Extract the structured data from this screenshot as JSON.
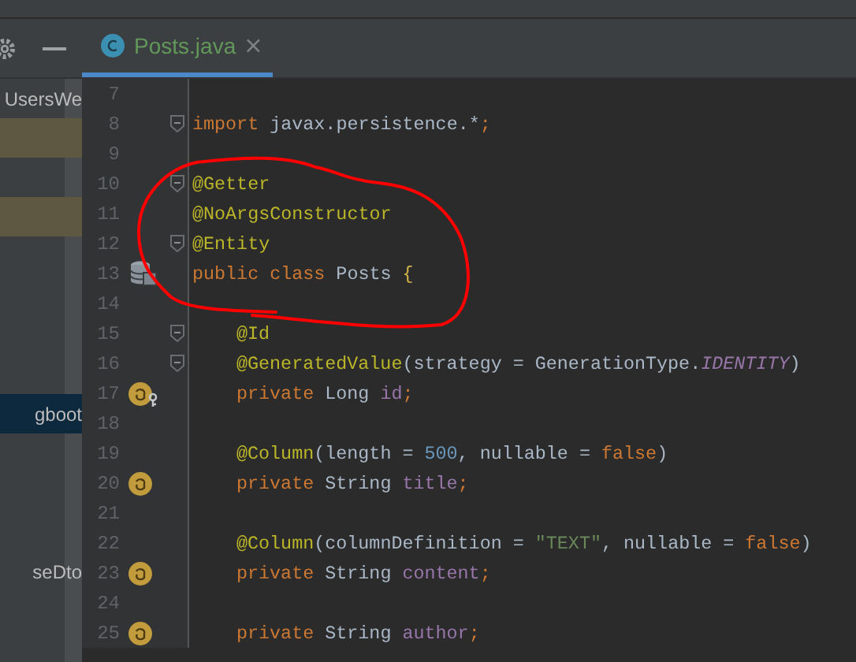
{
  "tab": {
    "label": "Posts.java",
    "selected": true
  },
  "sidebar": {
    "items": [
      {
        "text": "UsersWe",
        "highlighted": false,
        "selected": false
      },
      {
        "highlighted": true,
        "selected": false
      },
      {
        "highlighted": false,
        "selected": false
      },
      {
        "highlighted": true,
        "selected": false
      },
      {
        "highlighted": false,
        "selected": false
      },
      {
        "highlighted": false,
        "selected": false
      },
      {
        "highlighted": false,
        "selected": false
      },
      {
        "highlighted": false,
        "selected": false
      },
      {
        "text": "gboot",
        "highlighted": false,
        "selected": true
      },
      {
        "highlighted": false,
        "selected": false
      },
      {
        "highlighted": false,
        "selected": false
      },
      {
        "highlighted": false,
        "selected": false
      },
      {
        "text": "seDto",
        "highlighted": false,
        "selected": false
      }
    ]
  },
  "editor": {
    "lines": [
      {
        "n": "7",
        "kind": "plain",
        "fold": false
      },
      {
        "n": "8",
        "kind": "plain",
        "fold": true,
        "indent": false,
        "tokens": [
          {
            "t": "import",
            "kind": "kw"
          },
          {
            "t": " javax.persistence.*",
            "kind": "plain"
          },
          {
            "t": ";",
            "kind": "kw"
          }
        ]
      },
      {
        "n": "9",
        "kind": "plain",
        "fold": false
      },
      {
        "n": "10",
        "kind": "plain",
        "fold": true,
        "indent": false,
        "tokens": [
          {
            "t": "@Getter",
            "kind": "ann"
          }
        ]
      },
      {
        "n": "11",
        "kind": "plain",
        "fold": false,
        "indent": false,
        "tokens": [
          {
            "t": "@NoArgsConstructor",
            "kind": "ann"
          }
        ]
      },
      {
        "n": "12",
        "kind": "plain",
        "fold": true,
        "indent": false,
        "tokens": [
          {
            "t": "@Entity",
            "kind": "ann"
          }
        ]
      },
      {
        "n": "13",
        "kind": "entity",
        "fold": false,
        "indent": false,
        "tokens": [
          {
            "t": "public class",
            "kind": "kw"
          },
          {
            "t": " Posts ",
            "kind": "plain"
          },
          {
            "t": "{",
            "kind": "brace"
          }
        ]
      },
      {
        "n": "14",
        "kind": "plain",
        "fold": false
      },
      {
        "n": "15",
        "kind": "plain",
        "fold": true,
        "indent": true,
        "tokens": [
          {
            "t": "@Id",
            "kind": "ann"
          }
        ]
      },
      {
        "n": "16",
        "kind": "plain",
        "fold": true,
        "indent": true,
        "tokens": [
          {
            "t": "@GeneratedValue",
            "kind": "ann"
          },
          {
            "t": "(strategy = GenerationType.",
            "kind": "plain"
          },
          {
            "t": "IDENTITY",
            "kind": "static"
          },
          {
            "t": ")",
            "kind": "plain"
          }
        ]
      },
      {
        "n": "17",
        "kind": "id-field",
        "fold": false,
        "indent": true,
        "tokens": [
          {
            "t": "private",
            "kind": "kw"
          },
          {
            "t": " Long ",
            "kind": "plain"
          },
          {
            "t": "id",
            "kind": "field"
          },
          {
            "t": ";",
            "kind": "kw"
          }
        ]
      },
      {
        "n": "18",
        "kind": "plain",
        "fold": false
      },
      {
        "n": "19",
        "kind": "plain",
        "fold": false,
        "indent": true,
        "tokens": [
          {
            "t": "@Column",
            "kind": "ann"
          },
          {
            "t": "(length = ",
            "kind": "plain"
          },
          {
            "t": "500",
            "kind": "num"
          },
          {
            "t": ", nullable = ",
            "kind": "plain"
          },
          {
            "t": "false",
            "kind": "kw"
          },
          {
            "t": ")",
            "kind": "plain"
          }
        ]
      },
      {
        "n": "20",
        "kind": "field",
        "fold": false,
        "indent": true,
        "tokens": [
          {
            "t": "private",
            "kind": "kw"
          },
          {
            "t": " String ",
            "kind": "plain"
          },
          {
            "t": "title",
            "kind": "field"
          },
          {
            "t": ";",
            "kind": "kw"
          }
        ]
      },
      {
        "n": "21",
        "kind": "plain",
        "fold": false
      },
      {
        "n": "22",
        "kind": "plain",
        "fold": false,
        "indent": true,
        "tokens": [
          {
            "t": "@Column",
            "kind": "ann"
          },
          {
            "t": "(columnDefinition = ",
            "kind": "plain"
          },
          {
            "t": "\"TEXT\"",
            "kind": "str"
          },
          {
            "t": ", nullable = ",
            "kind": "plain"
          },
          {
            "t": "false",
            "kind": "kw"
          },
          {
            "t": ")",
            "kind": "plain"
          }
        ]
      },
      {
        "n": "23",
        "kind": "field",
        "fold": false,
        "indent": true,
        "tokens": [
          {
            "t": "private",
            "kind": "kw"
          },
          {
            "t": " String ",
            "kind": "plain"
          },
          {
            "t": "content",
            "kind": "field"
          },
          {
            "t": ";",
            "kind": "kw"
          }
        ]
      },
      {
        "n": "24",
        "kind": "plain",
        "fold": false
      },
      {
        "n": "25",
        "kind": "field",
        "fold": false,
        "indent": true,
        "tokens": [
          {
            "t": "private",
            "kind": "kw"
          },
          {
            "t": " String ",
            "kind": "plain"
          },
          {
            "t": "author",
            "kind": "field"
          },
          {
            "t": ";",
            "kind": "kw"
          }
        ]
      }
    ]
  },
  "annotations": [
    {
      "kind": "freehand-loop",
      "color": "#ff0000"
    }
  ]
}
